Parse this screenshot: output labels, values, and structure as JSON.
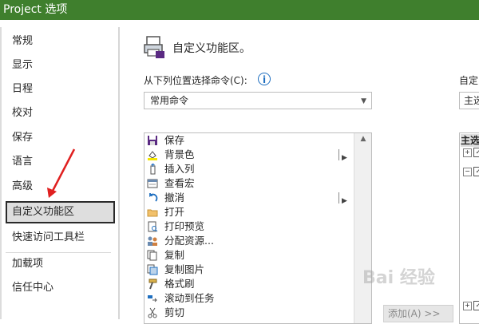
{
  "window": {
    "title": "Project 选项"
  },
  "sidebar": {
    "items": [
      {
        "label": "常规"
      },
      {
        "label": "显示"
      },
      {
        "label": "日程"
      },
      {
        "label": "校对"
      },
      {
        "label": "保存"
      },
      {
        "label": "语言"
      },
      {
        "label": "高级"
      },
      {
        "label": "自定义功能区",
        "selected": true
      },
      {
        "label": "快速访问工具栏"
      },
      {
        "label": "加载项"
      },
      {
        "label": "信任中心"
      }
    ]
  },
  "main": {
    "heading": "自定义功能区。",
    "choose_commands_label": "从下列位置选择命令(C):",
    "choose_commands_value": "常用命令",
    "customize_label": "自定",
    "customize_value": "主选",
    "commands": [
      {
        "label": "保存",
        "icon": "save-icon"
      },
      {
        "label": "背景色",
        "icon": "fill-color-icon",
        "flyout": true
      },
      {
        "label": "插入列",
        "icon": "insert-column-icon"
      },
      {
        "label": "查看宏",
        "icon": "macro-icon"
      },
      {
        "label": "撤消",
        "icon": "undo-icon",
        "flyout": true
      },
      {
        "label": "打开",
        "icon": "folder-open-icon"
      },
      {
        "label": "打印预览",
        "icon": "print-preview-icon"
      },
      {
        "label": "分配资源...",
        "icon": "assign-resources-icon"
      },
      {
        "label": "复制",
        "icon": "copy-icon"
      },
      {
        "label": "复制图片",
        "icon": "copy-picture-icon"
      },
      {
        "label": "格式刷",
        "icon": "format-painter-icon"
      },
      {
        "label": "滚动到任务",
        "icon": "scroll-to-task-icon"
      },
      {
        "label": "剪切",
        "icon": "cut-icon"
      }
    ],
    "right_list_header": "主选",
    "add_button": "添加(A) >>"
  },
  "annotation": {
    "color": "#e02020"
  },
  "watermark": "Bai 经验",
  "colors": {
    "titlebar": "#3f7f2d",
    "info": "#1f6fc0"
  }
}
